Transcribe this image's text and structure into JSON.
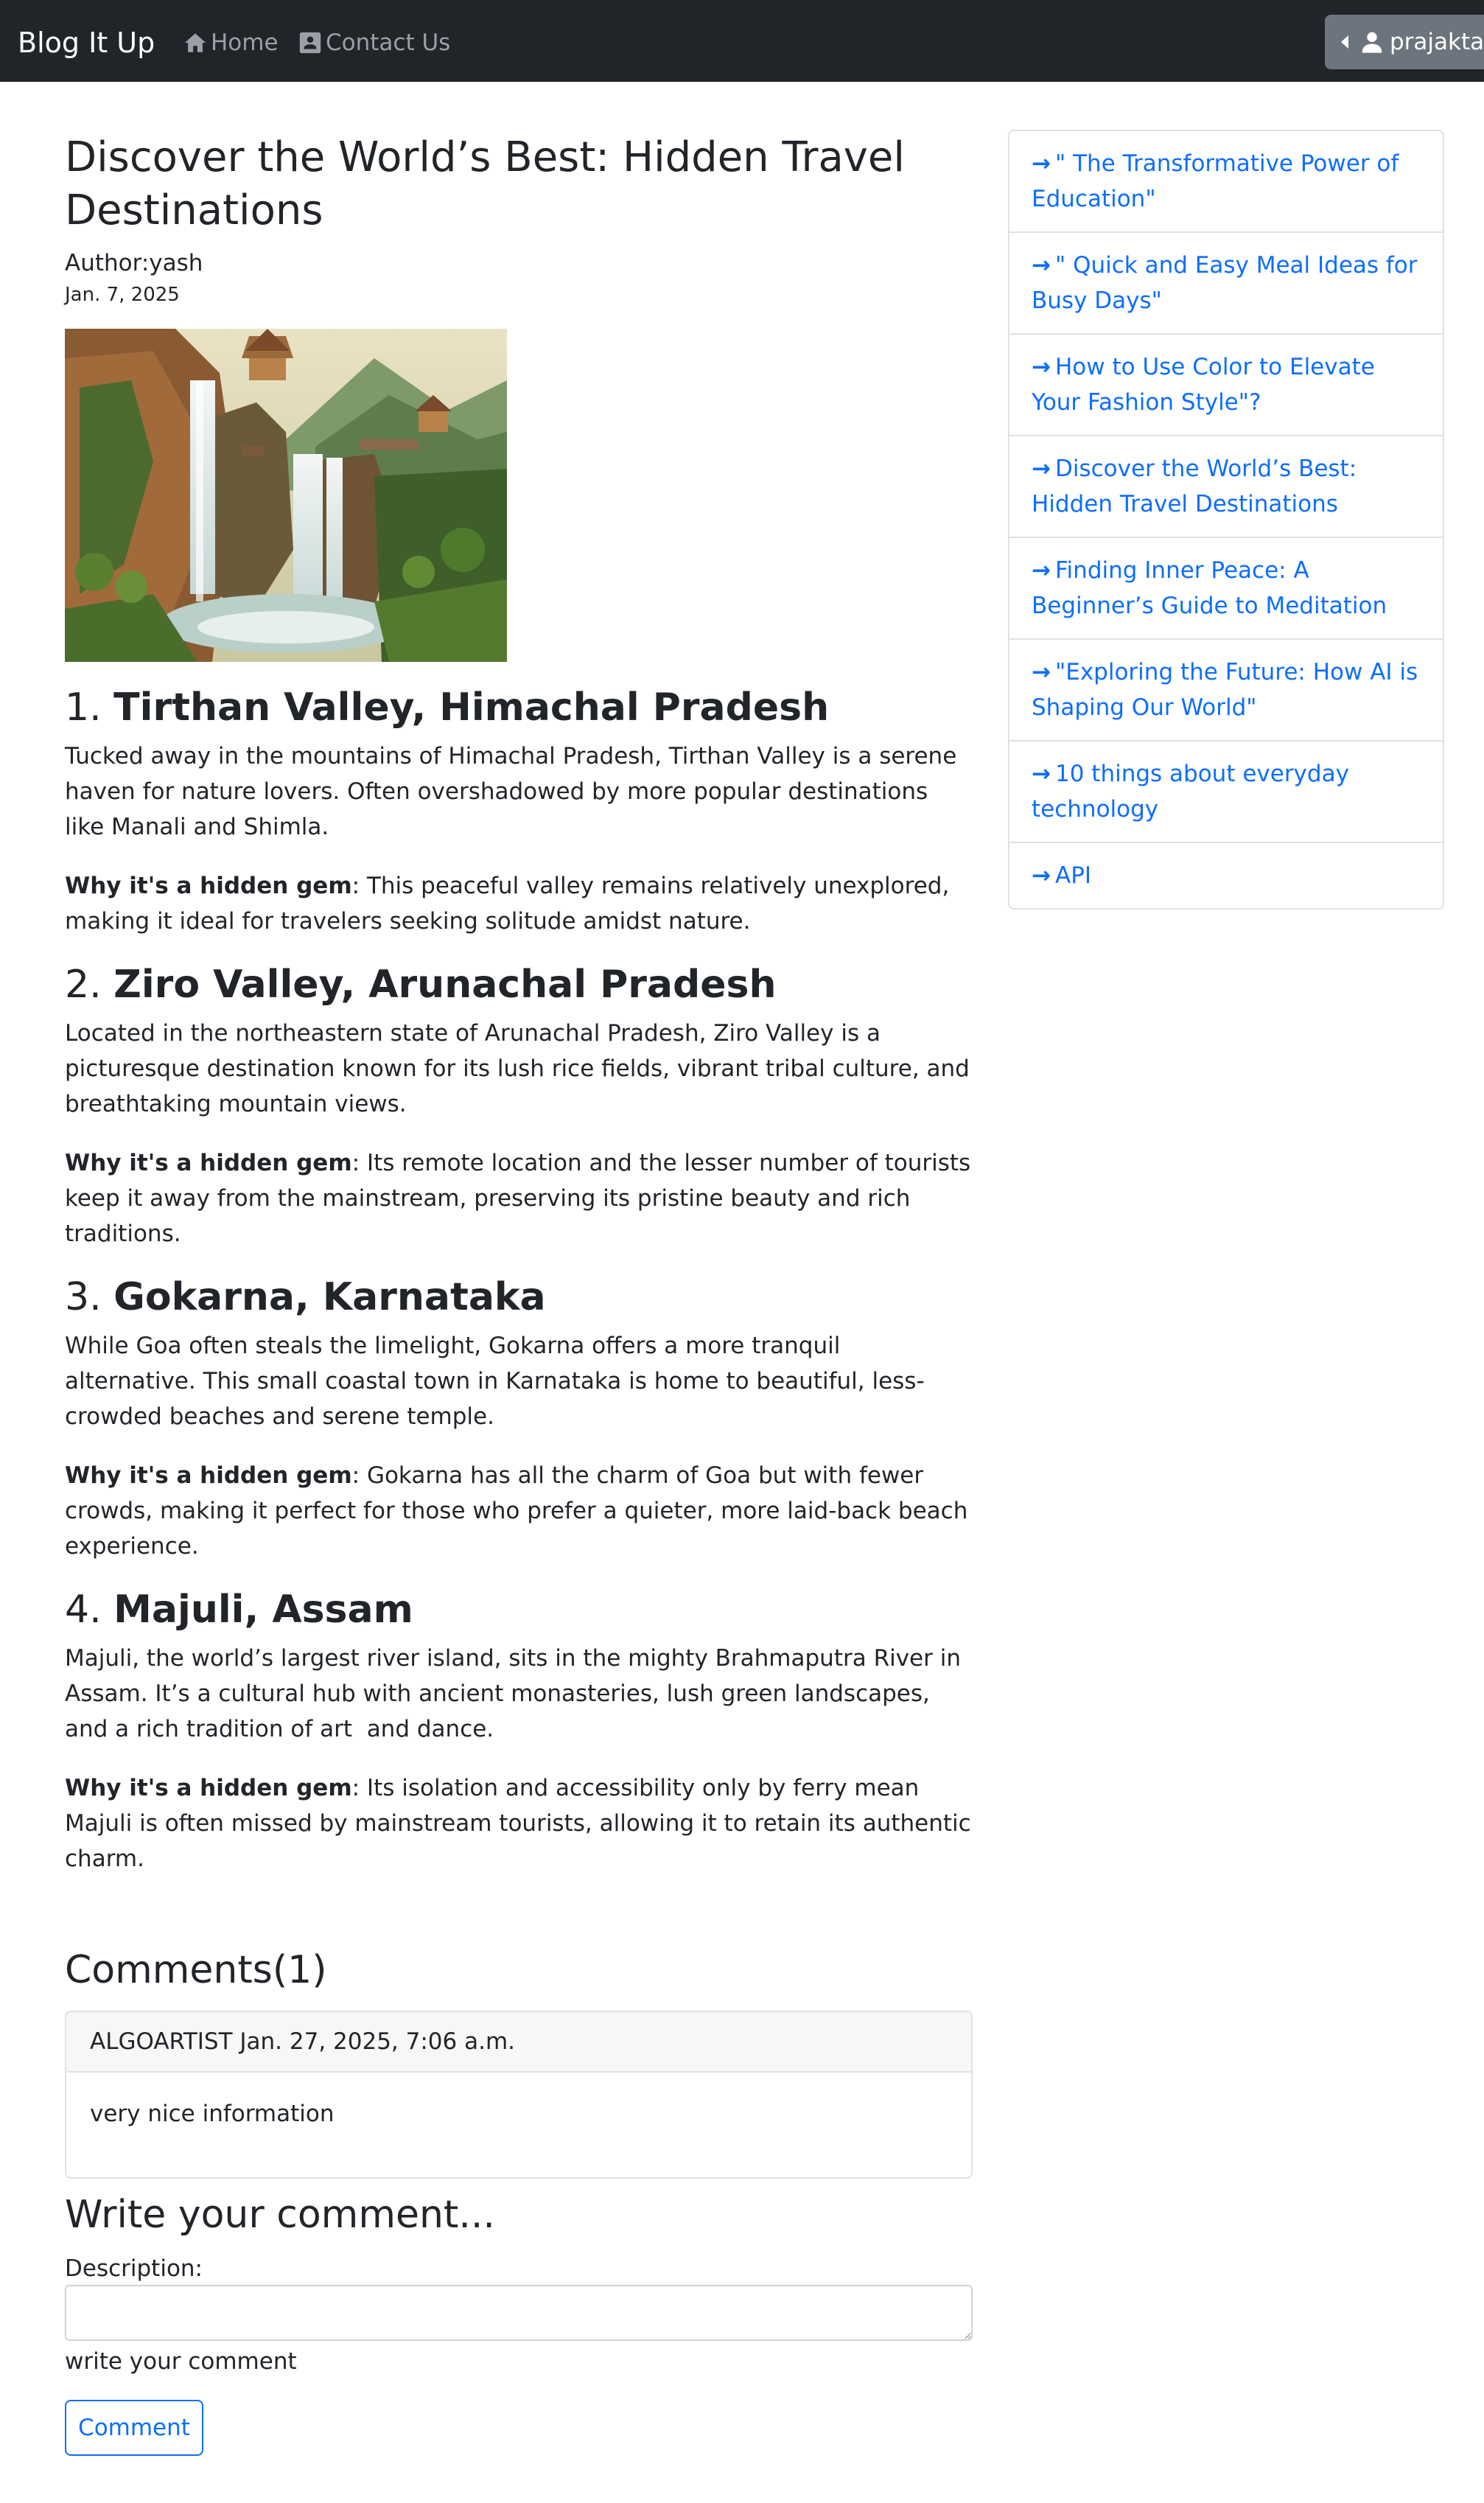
{
  "navbar": {
    "brand": "Blog It Up",
    "home_label": "Home",
    "contact_label": "Contact Us",
    "user_label": "prajakta"
  },
  "post": {
    "title": "Discover the World’s Best: Hidden Travel Destinations",
    "author": "Author:yash",
    "date": "Jan. 7, 2025",
    "sections": [
      {
        "number": "1. ",
        "heading": "Tirthan Valley, Himachal Pradesh",
        "body": "Tucked away in the mountains of Himachal Pradesh, Tirthan Valley is a serene haven for nature lovers. Often overshadowed by more popular destinations like Manali and Shimla.",
        "gem_label": "Why it's a hidden gem",
        "gem_text": ": This peaceful valley remains relatively unexplored, making it ideal for travelers seeking solitude amidst nature."
      },
      {
        "number": "2. ",
        "heading": "Ziro Valley, Arunachal Pradesh",
        "body": "Located in the northeastern state of Arunachal Pradesh, Ziro Valley is a picturesque destination known for its lush rice fields, vibrant tribal culture, and breathtaking mountain views.",
        "gem_label": "Why it's a hidden gem",
        "gem_text": ": Its remote location and the lesser number of tourists keep it away from the mainstream, preserving its pristine beauty and rich traditions."
      },
      {
        "number": "3. ",
        "heading": "Gokarna, Karnataka",
        "body": "While Goa often steals the limelight, Gokarna offers a more tranquil alternative. This small coastal town in Karnataka is home to beautiful, less-crowded beaches and serene temple.",
        "gem_label": "Why it's a hidden gem",
        "gem_text": ": Gokarna has all the charm of Goa but with fewer crowds, making it perfect for those who prefer a quieter, more laid-back beach experience."
      },
      {
        "number": "4. ",
        "heading": "Majuli, Assam",
        "body": "Majuli, the world’s largest river island, sits in the mighty Brahmaputra River in Assam. It’s a cultural hub with ancient monasteries, lush green landscapes, and a rich tradition of art  and dance.",
        "gem_label": "Why it's a hidden gem",
        "gem_text": ": Its isolation and accessibility only by ferry mean Majuli is often missed by mainstream tourists, allowing it to retain its authentic charm."
      }
    ]
  },
  "comments": {
    "title": "Comments(1)",
    "items": [
      {
        "header": "ALGOARTIST Jan. 27, 2025, 7:06 a.m.",
        "body": "very nice information"
      }
    ]
  },
  "comment_form": {
    "title": "Write your comment...",
    "label": "Description:",
    "help_text": "write your comment",
    "submit_label": "Comment"
  },
  "sidebar": {
    "items": [
      {
        "label": "\" The Transformative Power of Education\""
      },
      {
        "label": "\" Quick and Easy Meal Ideas for Busy Days\""
      },
      {
        "label": "How to Use Color to Elevate Your Fashion Style\"?"
      },
      {
        "label": "Discover the World’s Best: Hidden Travel Destinations"
      },
      {
        "label": "Finding Inner Peace: A Beginner’s Guide to Meditation"
      },
      {
        "label": "\"Exploring the Future: How AI is Shaping Our World\""
      },
      {
        "label": "10 things about everyday technology"
      },
      {
        "label": "API"
      }
    ]
  },
  "colors": {
    "navbar_bg": "#212529",
    "link": "#0d6efd",
    "user_button": "#6c757d"
  },
  "icons": {
    "home": "home-icon",
    "contact": "contact-card-icon",
    "user": "user-icon",
    "caret": "caret-left-icon",
    "arrow": "arrow-right-icon"
  }
}
